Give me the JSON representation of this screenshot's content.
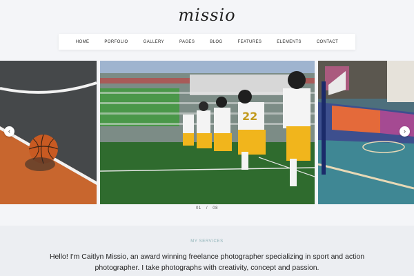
{
  "header": {
    "logo": "missio"
  },
  "nav": {
    "items": [
      "HOME",
      "PORFOLIO",
      "GALLERY",
      "PAGES",
      "BLOG",
      "FEATURES",
      "ELEMENTS",
      "CONTACT"
    ]
  },
  "slider": {
    "current": "01",
    "separator": "/",
    "total": "08",
    "prev_icon": "chevron-left-icon",
    "next_icon": "chevron-right-icon",
    "slides": [
      {
        "subject": "basketball on court"
      },
      {
        "subject": "football players lining up",
        "jersey_number": "22"
      },
      {
        "subject": "colorful basketball court"
      }
    ]
  },
  "services": {
    "label": "MY SERVICES",
    "intro": "Hello! I'm Caitlyn Missio, an award winning freelance photographer specializing in sport and action photographer. I take photographs with creativity, concept and passion."
  },
  "colors": {
    "accent": "#8fb3b8",
    "court_orange": "#c8662e",
    "court_gray": "#4a4c4e",
    "field_green": "#2f6b2e",
    "jersey_gold": "#f1b51c"
  }
}
